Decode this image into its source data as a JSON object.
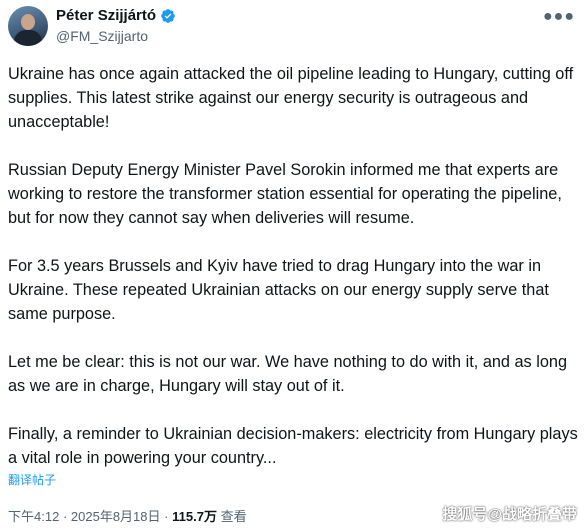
{
  "author": {
    "display_name": "Péter Szijjártó",
    "handle": "@FM_Szijjarto",
    "verified_color": "#1d9bf0"
  },
  "more_icon": "more-horizontal-icon",
  "paragraphs": [
    "Ukraine has once again attacked the oil pipeline leading to Hungary, cutting off supplies. This latest strike against our energy security is outrageous and unacceptable!",
    "Russian Deputy Energy Minister Pavel Sorokin informed me that experts are working to restore the transformer station essential for operating the pipeline, but for now they cannot say when deliveries will resume.",
    "For 3.5 years Brussels and Kyiv have tried to drag Hungary into the war in Ukraine. These repeated Ukrainian attacks on our energy supply serve that same purpose.",
    "Let me be clear: this is not our war. We have nothing to do with it, and as long as we are in charge, Hungary will stay out of it.",
    "Finally, a reminder to Ukrainian decision-makers: electricity from Hungary plays a vital role in powering your country..."
  ],
  "translate_label": "翻译帖子",
  "meta": {
    "time": "下午4:12",
    "separator": "·",
    "date": "2025年8月18日",
    "views_count": "115.7万",
    "views_label": "查看"
  },
  "watermark": "搜狐号@战略折叠带",
  "colors": {
    "text": "#0f1419",
    "secondary": "#536471",
    "link": "#1d9bf0"
  }
}
